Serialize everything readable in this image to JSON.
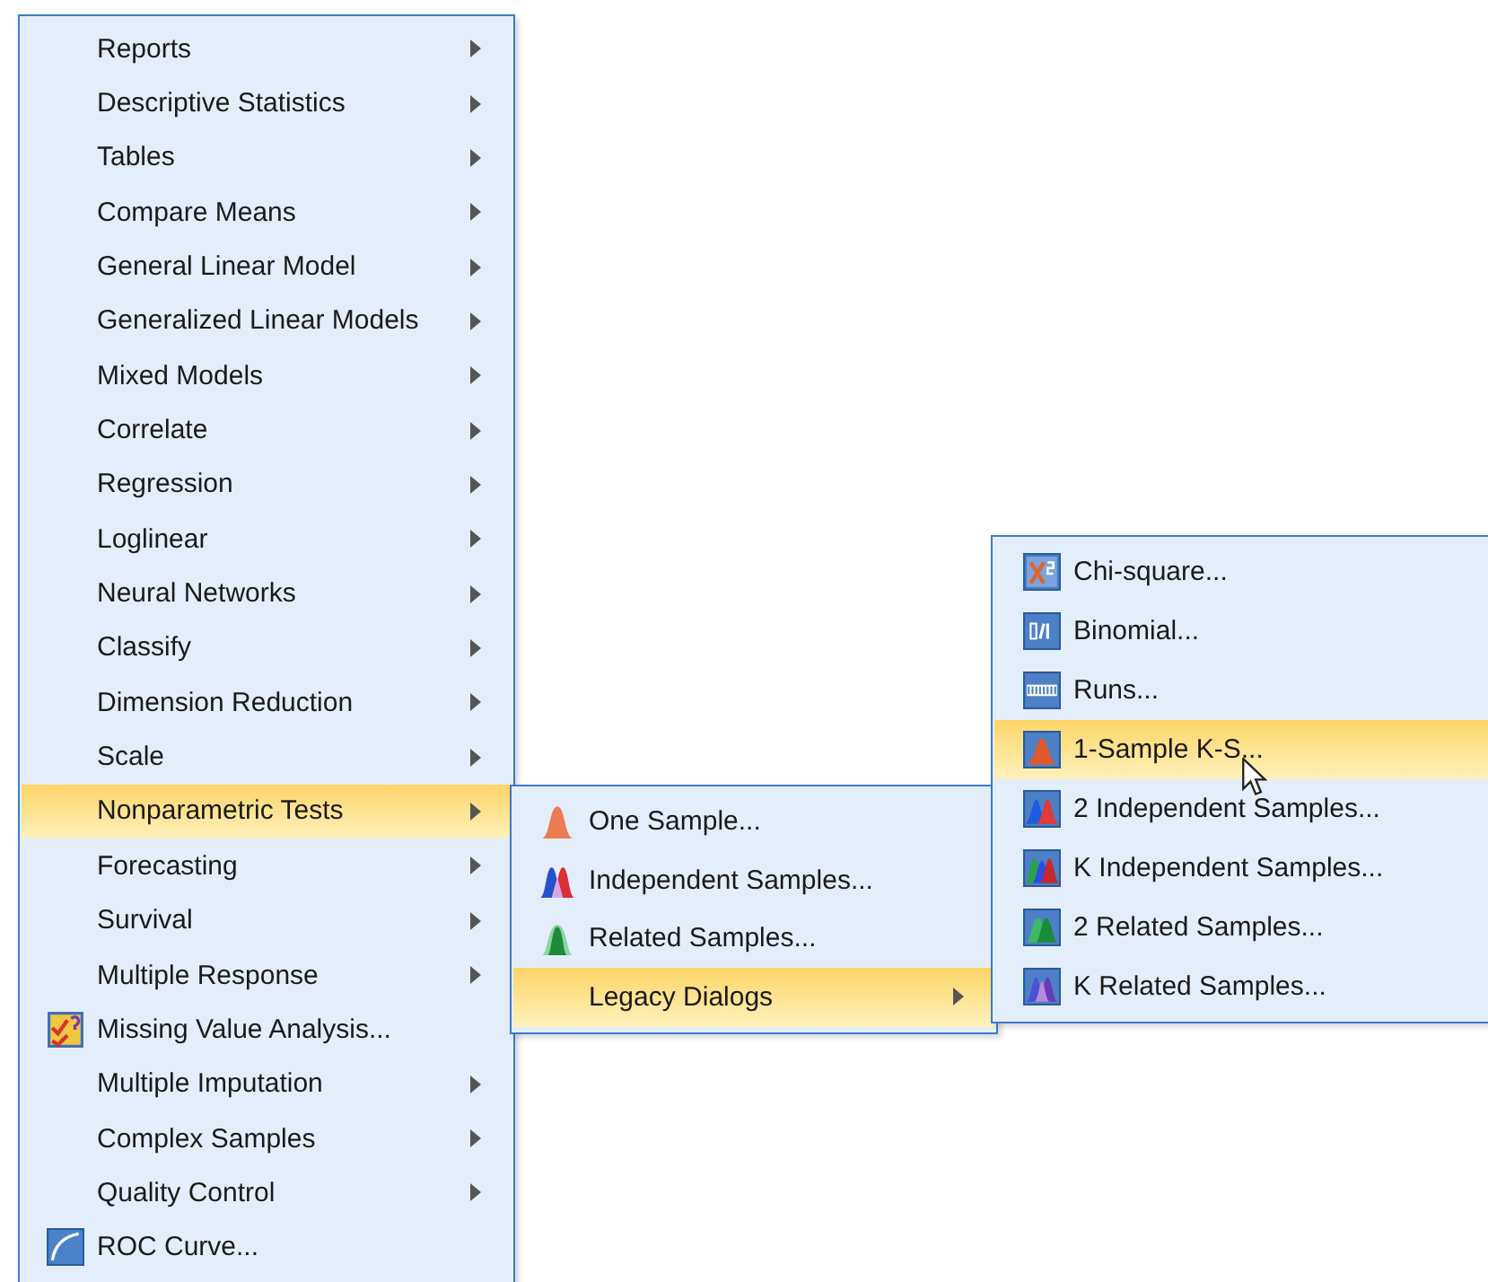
{
  "main_menu": {
    "items": [
      {
        "label": "Reports",
        "submenu": true,
        "selected": false
      },
      {
        "label": "Descriptive Statistics",
        "submenu": true,
        "selected": false
      },
      {
        "label": "Tables",
        "submenu": true,
        "selected": false
      },
      {
        "label": "Compare Means",
        "submenu": true,
        "selected": false
      },
      {
        "label": "General Linear Model",
        "submenu": true,
        "selected": false
      },
      {
        "label": "Generalized Linear Models",
        "submenu": true,
        "selected": false
      },
      {
        "label": "Mixed Models",
        "submenu": true,
        "selected": false
      },
      {
        "label": "Correlate",
        "submenu": true,
        "selected": false
      },
      {
        "label": "Regression",
        "submenu": true,
        "selected": false
      },
      {
        "label": "Loglinear",
        "submenu": true,
        "selected": false
      },
      {
        "label": "Neural Networks",
        "submenu": true,
        "selected": false
      },
      {
        "label": "Classify",
        "submenu": true,
        "selected": false
      },
      {
        "label": "Dimension Reduction",
        "submenu": true,
        "selected": false
      },
      {
        "label": "Scale",
        "submenu": true,
        "selected": false
      },
      {
        "label": "Nonparametric Tests",
        "submenu": true,
        "selected": true
      },
      {
        "label": "Forecasting",
        "submenu": true,
        "selected": false
      },
      {
        "label": "Survival",
        "submenu": true,
        "selected": false
      },
      {
        "label": "Multiple Response",
        "submenu": true,
        "selected": false
      },
      {
        "label": "Missing Value Analysis...",
        "submenu": false,
        "selected": false
      },
      {
        "label": "Multiple Imputation",
        "submenu": true,
        "selected": false
      },
      {
        "label": "Complex Samples",
        "submenu": true,
        "selected": false
      },
      {
        "label": "Quality Control",
        "submenu": true,
        "selected": false
      },
      {
        "label": "ROC Curve...",
        "submenu": false,
        "selected": false
      }
    ]
  },
  "nonparametric_menu": {
    "items": [
      {
        "label": "One Sample...",
        "submenu": false,
        "selected": false
      },
      {
        "label": "Independent Samples...",
        "submenu": false,
        "selected": false
      },
      {
        "label": "Related Samples...",
        "submenu": false,
        "selected": false
      },
      {
        "label": "Legacy Dialogs",
        "submenu": true,
        "selected": true
      }
    ]
  },
  "legacy_menu": {
    "items": [
      {
        "label": "Chi-square...",
        "submenu": false,
        "selected": false
      },
      {
        "label": "Binomial...",
        "submenu": false,
        "selected": false
      },
      {
        "label": "Runs...",
        "submenu": false,
        "selected": false
      },
      {
        "label": "1-Sample K-S...",
        "submenu": false,
        "selected": true
      },
      {
        "label": "2 Independent Samples...",
        "submenu": false,
        "selected": false
      },
      {
        "label": "K Independent Samples...",
        "submenu": false,
        "selected": false
      },
      {
        "label": "2 Related Samples...",
        "submenu": false,
        "selected": false
      },
      {
        "label": "K Related Samples...",
        "submenu": false,
        "selected": false
      }
    ]
  }
}
